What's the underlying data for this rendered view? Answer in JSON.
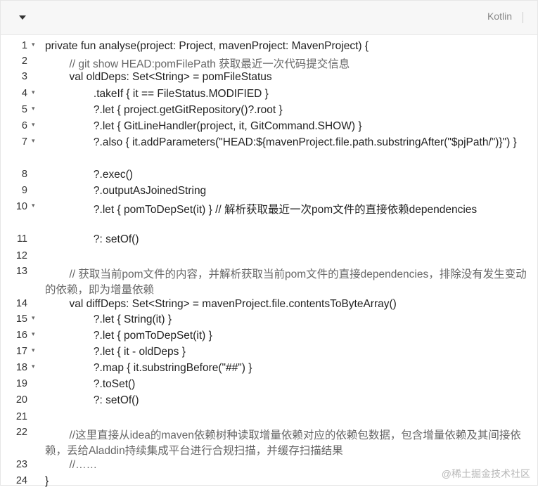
{
  "toolbar": {
    "collapse_icon": "chevron-down-icon",
    "language": "Kotlin"
  },
  "colors": {
    "keyword": "#c7254e",
    "type": "#1f5fbf",
    "comment": "#666666",
    "text": "#222222",
    "toolbar_bg": "#f7f7f7"
  },
  "code": {
    "lines": [
      {
        "num": "1",
        "fold": true,
        "text": "private fun analyse(project: Project, mavenProject: MavenProject) {"
      },
      {
        "num": "2",
        "fold": false,
        "text": "        // git show HEAD:pomFilePath 获取最近一次代码提交信息"
      },
      {
        "num": "3",
        "fold": false,
        "text": "        val oldDeps: Set<String> = pomFileStatus"
      },
      {
        "num": "4",
        "fold": true,
        "text": "                .takeIf { it == FileStatus.MODIFIED }"
      },
      {
        "num": "5",
        "fold": true,
        "text": "                ?.let { project.getGitRepository()?.root }"
      },
      {
        "num": "6",
        "fold": true,
        "text": "                ?.let { GitLineHandler(project, it, GitCommand.SHOW) }"
      },
      {
        "num": "7",
        "fold": true,
        "text": "                ?.also { it.addParameters(\"HEAD:${mavenProject.file.path.substringAfter(\"$pjPath/\")}\") }"
      },
      {
        "num": "8",
        "fold": false,
        "text": "                ?.exec()"
      },
      {
        "num": "9",
        "fold": false,
        "text": "                ?.outputAsJoinedString"
      },
      {
        "num": "10",
        "fold": true,
        "text": "                ?.let { pomToDepSet(it) } // 解析获取最近一次pom文件的直接依赖dependencies"
      },
      {
        "num": "11",
        "fold": false,
        "text": "                ?: setOf()"
      },
      {
        "num": "12",
        "fold": false,
        "text": ""
      },
      {
        "num": "13",
        "fold": false,
        "text": "        // 获取当前pom文件的内容，并解析获取当前pom文件的直接dependencies，排除没有发生变动的依赖，即为增量依赖"
      },
      {
        "num": "14",
        "fold": false,
        "text": "        val diffDeps: Set<String> = mavenProject.file.contentsToByteArray()"
      },
      {
        "num": "15",
        "fold": true,
        "text": "                ?.let { String(it) }"
      },
      {
        "num": "16",
        "fold": true,
        "text": "                ?.let { pomToDepSet(it) }"
      },
      {
        "num": "17",
        "fold": true,
        "text": "                ?.let { it - oldDeps }"
      },
      {
        "num": "18",
        "fold": true,
        "text": "                ?.map { it.substringBefore(\"##\") }"
      },
      {
        "num": "19",
        "fold": false,
        "text": "                ?.toSet()"
      },
      {
        "num": "20",
        "fold": false,
        "text": "                ?: setOf()"
      },
      {
        "num": "21",
        "fold": false,
        "text": ""
      },
      {
        "num": "22",
        "fold": false,
        "text": "        //这里直接从idea的maven依赖树种读取增量依赖对应的依赖包数据，包含增量依赖及其间接依赖，丢给Aladdin持续集成平台进行合规扫描，并缓存扫描结果"
      },
      {
        "num": "23",
        "fold": false,
        "text": "        //……"
      },
      {
        "num": "24",
        "fold": false,
        "text": "}"
      }
    ]
  },
  "watermark": "@稀土掘金技术社区"
}
